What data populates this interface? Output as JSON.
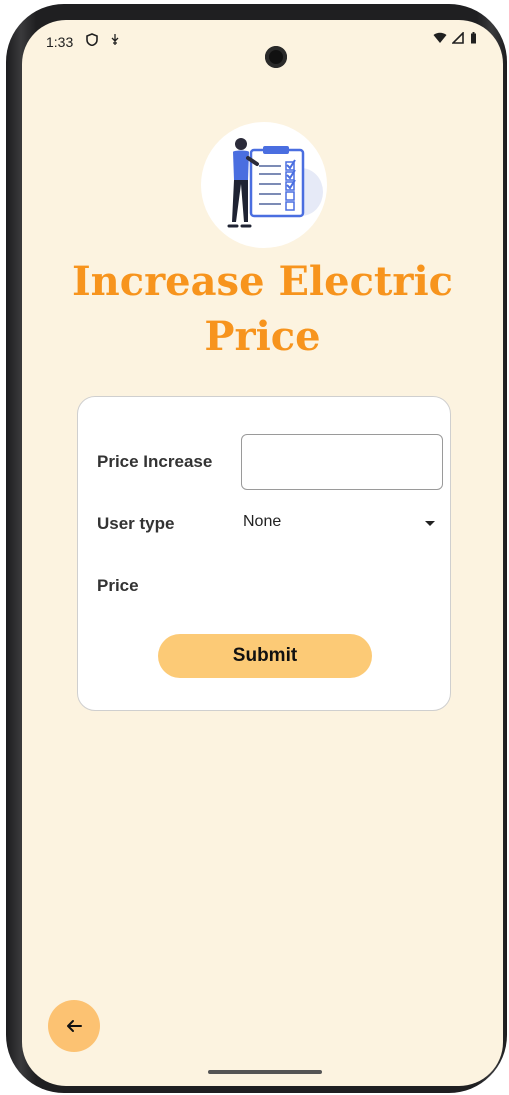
{
  "status_bar": {
    "time": "1:33",
    "left_icons": [
      "shield-icon",
      "usb-icon"
    ],
    "right_icons": [
      "wifi-icon",
      "signal-icon",
      "battery-icon"
    ]
  },
  "header": {
    "illustration": "checklist-illustration",
    "title": "Increase Electric Price"
  },
  "form": {
    "price_increase_label": "Price Increase",
    "price_increase_value": "",
    "user_type_label": "User type",
    "user_type_selected": "None",
    "price_label": "Price",
    "price_value": "",
    "submit_label": "Submit"
  },
  "navigation": {
    "back_icon": "arrow-left-icon"
  },
  "colors": {
    "background": "#fcf3e0",
    "title": "#f7941d",
    "button": "#fcca76",
    "fab": "#fcc272"
  }
}
